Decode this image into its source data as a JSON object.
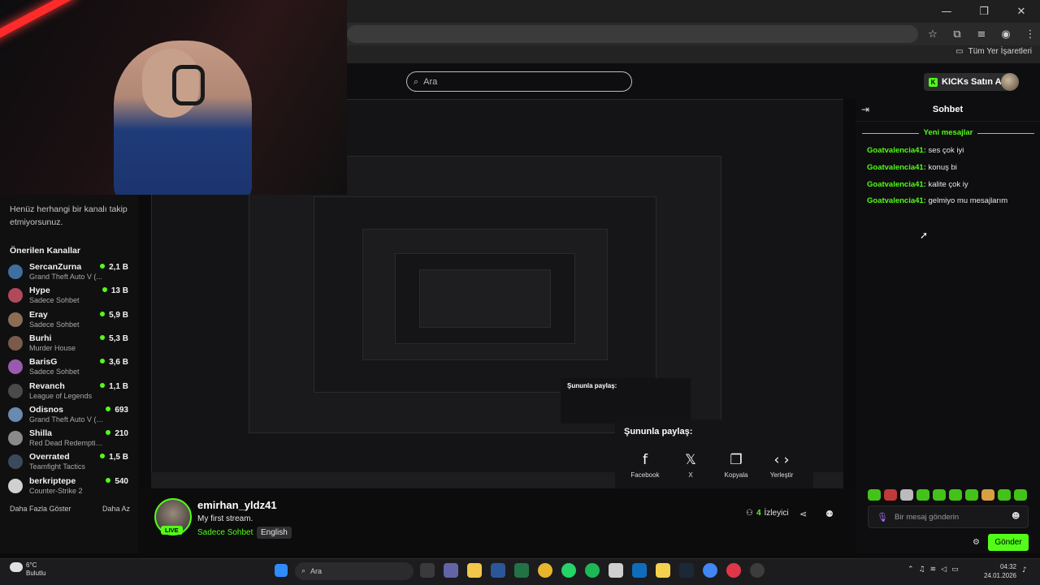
{
  "browser": {
    "bookmarks_label": "Tüm Yer İşaretleri",
    "window_buttons": [
      "—",
      "❐",
      "✕"
    ]
  },
  "header": {
    "search_placeholder": "Ara",
    "kicks_label": "KICKs Satın Al"
  },
  "sidebar": {
    "follow_note": "Henüz herhangi bir kanalı takip etmiyorsunuz.",
    "section_title": "Önerilen Kanallar",
    "channels": [
      {
        "name": "SercanZurna",
        "game": "Grand Theft Auto V (...",
        "viewers": "2,1 B",
        "color": "#3f6fa0"
      },
      {
        "name": "Hype",
        "game": "Sadece Sohbet",
        "viewers": "13 B",
        "color": "#b04a5a"
      },
      {
        "name": "Eray",
        "game": "Sadece Sohbet",
        "viewers": "5,9 B",
        "color": "#8a6d55"
      },
      {
        "name": "Burhi",
        "game": "Murder House",
        "viewers": "5,3 B",
        "color": "#7a5a4a"
      },
      {
        "name": "BarisG",
        "game": "Sadece Sohbet",
        "viewers": "3,6 B",
        "color": "#9a5ab0"
      },
      {
        "name": "Revanch",
        "game": "League of Legends",
        "viewers": "1,1 B",
        "color": "#4a4a4a"
      },
      {
        "name": "Odisnos",
        "game": "Grand Theft Auto V (G...",
        "viewers": "693",
        "color": "#6a8ab0"
      },
      {
        "name": "Shilla",
        "game": "Red Dead Redemption II",
        "viewers": "210",
        "color": "#8a8a8a"
      },
      {
        "name": "Overrated",
        "game": "Teamfight Tactics",
        "viewers": "1,5 B",
        "color": "#3a4a5a"
      },
      {
        "name": "berkriptepe",
        "game": "Counter-Strike 2",
        "viewers": "540",
        "color": "#d0d0d0"
      }
    ],
    "show_more": "Daha Fazla Göster",
    "show_less": "Daha Az"
  },
  "share": {
    "title": "Şununla paylaş:",
    "items": [
      {
        "label": "Facebook",
        "icon": "facebook-icon",
        "glyph": "f"
      },
      {
        "label": "X",
        "icon": "x-icon",
        "glyph": "𝕏"
      },
      {
        "label": "Kopyala",
        "icon": "copy-icon",
        "glyph": "❐"
      },
      {
        "label": "Yerleştir",
        "icon": "embed-icon",
        "glyph": "‹ ›"
      }
    ]
  },
  "stream": {
    "streamer": "emirhan_yldz41",
    "title": "My first stream.",
    "category": "Sadece Sohbet",
    "language": "English",
    "live_badge": "LIVE",
    "viewer_count": "4",
    "viewer_label": "İzleyici"
  },
  "chat": {
    "title": "Sohbet",
    "new_messages": "Yeni mesajlar",
    "messages": [
      {
        "user": "Goatvalencia41:",
        "text": " ses çok iyi"
      },
      {
        "user": "Goatvalencia41:",
        "text": " konuş bi"
      },
      {
        "user": "Goatvalencia41:",
        "text": " kalite çok iy"
      },
      {
        "user": "Goatvalencia41:",
        "text": " gelmiyo mu mesajlarım"
      }
    ],
    "input_placeholder": "Bir mesaj gönderin",
    "send_label": "Gönder"
  },
  "taskbar": {
    "temperature": "6°C",
    "weather": "Bulutlu",
    "search_placeholder": "Ara",
    "time": "04:32",
    "date": "24.01.2026"
  },
  "colors": {
    "accent": "#53fc18",
    "background": "#0b0b0c"
  }
}
